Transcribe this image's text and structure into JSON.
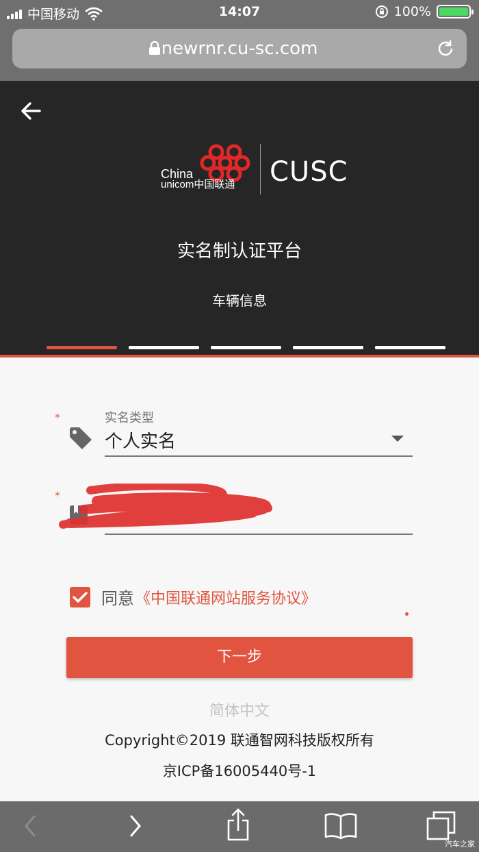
{
  "status_bar": {
    "carrier": "中国移动",
    "time": "14:07",
    "battery": "100%",
    "battery_level": 1.0
  },
  "browser": {
    "url": "newrnr.cu-sc.com"
  },
  "header": {
    "logo_china": "China",
    "logo_unicom": "unicom中国联通",
    "logo_brand": "CUSC",
    "title": "实名制认证平台",
    "subtitle": "车辆信息",
    "steps_total": 5,
    "step_active": 1
  },
  "form": {
    "type_field": {
      "required_mark": "*",
      "label": "实名类型",
      "value": "个人实名"
    },
    "id_field": {
      "required_mark": "*"
    },
    "agree": {
      "checked": true,
      "text": "同意",
      "link": "《中国联通网站服务协议》"
    },
    "next_button": "下一步"
  },
  "footer": {
    "language": "简体中文",
    "copyright": "Copyright©2019 联通智网科技版权所有",
    "icp": "京ICP备16005440号-1"
  },
  "watermark": "汽车之家",
  "colors": {
    "accent": "#e05440",
    "header_bg": "#262626",
    "chrome_bg": "#6f6f6f"
  }
}
